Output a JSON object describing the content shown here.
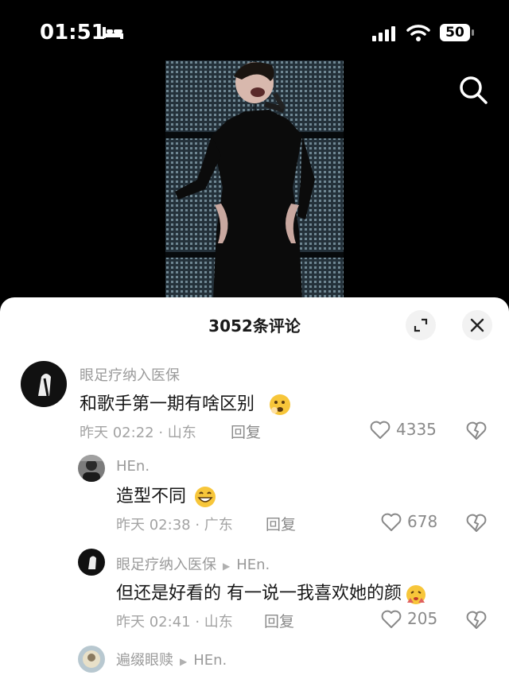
{
  "status_bar": {
    "time": "01:51",
    "battery": "50",
    "icons": [
      "bed-icon",
      "signal-icon",
      "wifi-icon",
      "battery-icon"
    ]
  },
  "header": {
    "search_icon": "search-icon"
  },
  "comments_sheet": {
    "title": "3052条评论",
    "expand_icon": "expand-icon",
    "close_icon": "close-icon",
    "comments": [
      {
        "username": "眼足疗纳入医保",
        "text": "和歌手第一期有啥区别",
        "emoji": "thinking-emoji",
        "time_location": "昨天 02:22 · 山东",
        "reply_label": "回复",
        "likes": "4335"
      },
      {
        "username": "HEn.",
        "text": "造型不同",
        "emoji": "grin-emoji",
        "time_location": "昨天 02:38 · 广东",
        "reply_label": "回复",
        "likes": "678"
      },
      {
        "username": "眼足疗纳入医保",
        "reply_to": "HEn.",
        "text": "但还是好看的  有一说一我喜欢她的颜",
        "emoji": "shy-emoji",
        "time_location": "昨天 02:41 · 山东",
        "reply_label": "回复",
        "likes": "205"
      },
      {
        "username": "遍缀眼赎",
        "reply_to": "HEn.",
        "text": ""
      }
    ]
  },
  "colors": {
    "sheet_bg": "#ffffff",
    "muted": "#9a9a9a",
    "text": "#161616"
  }
}
